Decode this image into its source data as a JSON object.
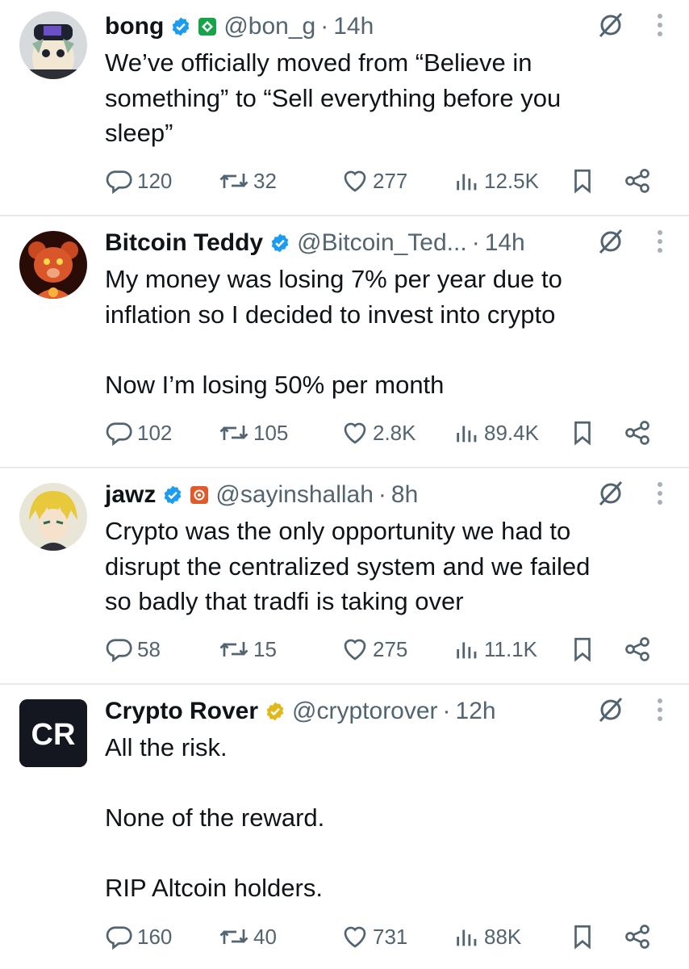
{
  "tweets": [
    {
      "name": "bong",
      "handle": "@bon_g",
      "time": "14h",
      "text": "We’ve officially moved from “Believe in\nsomething” to “Sell everything before you\nsleep”",
      "replies": "120",
      "retweets": "32",
      "likes": "277",
      "views": "12.5K",
      "verified_color": "#1d9bf0",
      "affiliate_color": "#17a34a"
    },
    {
      "name": "Bitcoin Teddy",
      "handle": "@Bitcoin_Ted...",
      "time": "14h",
      "text": "My money was losing 7% per year due to\ninflation so I decided to invest into crypto\n\nNow I’m losing 50% per month",
      "replies": "102",
      "retweets": "105",
      "likes": "2.8K",
      "views": "89.4K",
      "verified_color": "#1d9bf0"
    },
    {
      "name": "jawz",
      "handle": "@sayinshallah",
      "time": "8h",
      "text": "Crypto was the only opportunity we had to\ndisrupt the centralized system and we failed\nso badly that tradfi is taking over",
      "replies": "58",
      "retweets": "15",
      "likes": "275",
      "views": "11.1K",
      "verified_color": "#1d9bf0",
      "affiliate_color": "#e05a2b"
    },
    {
      "name": "Crypto Rover",
      "handle": "@cryptorover",
      "time": "12h",
      "text": "All the risk.\n\nNone of the reward.\n\nRIP Altcoin holders.",
      "replies": "160",
      "retweets": "40",
      "likes": "731",
      "views": "88K",
      "verified_color": "#e2b719",
      "avatar_text": "CR"
    }
  ],
  "separator": "·",
  "icons": {
    "reply": "reply-icon",
    "retweet": "retweet-icon",
    "like": "like-icon",
    "views": "views-icon",
    "bookmark": "bookmark-icon",
    "share": "share-icon",
    "grok": "grok-icon",
    "more": "more-icon"
  }
}
